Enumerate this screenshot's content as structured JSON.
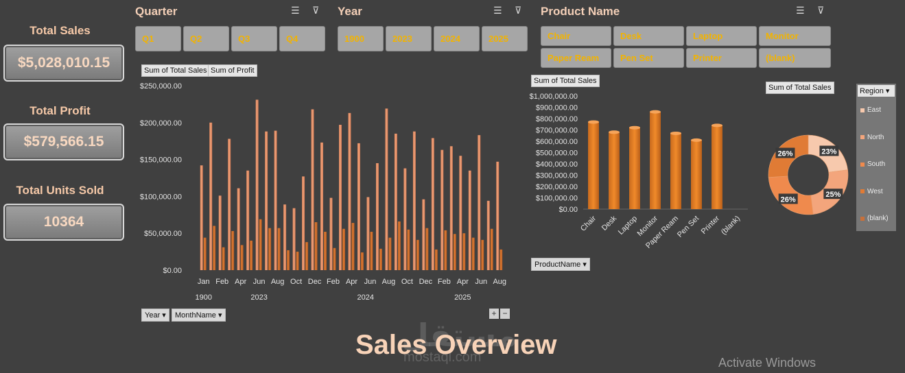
{
  "kpis": [
    {
      "title": "Total Sales",
      "value": "$5,028,010.15"
    },
    {
      "title": "Total Profit",
      "value": "$579,566.15"
    },
    {
      "title": "Total Units Sold",
      "value": "10364"
    }
  ],
  "slicers": {
    "quarter": {
      "title": "Quarter",
      "items": [
        "Q1",
        "Q2",
        "Q3",
        "Q4"
      ]
    },
    "year": {
      "title": "Year",
      "items": [
        "1900",
        "2023",
        "2024",
        "2025"
      ]
    },
    "product": {
      "title": "Product Name",
      "items": [
        "Chair",
        "Desk",
        "Laptop",
        "Monitor",
        "Paper Ream",
        "Pen Set",
        "Printer",
        "(blank)"
      ]
    }
  },
  "icons": {
    "multiselect": "multi-select-icon",
    "clearfilter": "clear-filter-icon"
  },
  "colors": {
    "sales": "#f1a37a",
    "profit": "#e07b35",
    "bar": "#f08a2a",
    "accent": "#f2b300"
  },
  "monthly_chart_fields": {
    "values": [
      "Sum of Total Sales",
      "Sum of Profit"
    ],
    "axis": [
      "Year",
      "MonthName"
    ]
  },
  "product_chart_fields": {
    "value": "Sum of Total Sales",
    "axis": "ProductName"
  },
  "donut_fields": {
    "value": "Sum of Total Sales",
    "legend_header": "Region"
  },
  "chart_data": [
    {
      "type": "bar",
      "categories": [
        "Jan",
        "Feb",
        "Mar",
        "Apr",
        "May",
        "Jun",
        "Jul",
        "Aug",
        "Sep",
        "Oct",
        "Nov",
        "Dec",
        "Jan",
        "Feb",
        "Mar",
        "Apr",
        "May",
        "Jun",
        "Jul",
        "Aug",
        "Sep",
        "Oct",
        "Nov",
        "Dec",
        "Jan",
        "Feb",
        "Mar",
        "Apr",
        "May",
        "Jun",
        "Jul",
        "Aug",
        "Sep"
      ],
      "tick_labels": [
        "Jan",
        "Feb",
        "Apr",
        "Jun",
        "Aug",
        "Oct",
        "Dec",
        "Feb",
        "Apr",
        "Jun",
        "Aug",
        "Oct",
        "Dec",
        "Feb",
        "Apr",
        "Jun",
        "Aug"
      ],
      "groups": [
        {
          "label": "1900",
          "count": 1
        },
        {
          "label": "2023",
          "count": 11
        },
        {
          "label": "2024",
          "count": 12
        },
        {
          "label": "2025",
          "count": 9
        }
      ],
      "series": [
        {
          "name": "Sum of Total Sales",
          "values": [
            142000,
            200000,
            101000,
            178000,
            111000,
            135000,
            231000,
            188000,
            189000,
            89000,
            84000,
            127000,
            218000,
            173000,
            98000,
            197000,
            213000,
            172000,
            99000,
            145000,
            219000,
            185000,
            138000,
            188000,
            96000,
            179000,
            163000,
            168000,
            155000,
            135000,
            183000,
            94000,
            147000
          ]
        },
        {
          "name": "Sum of Profit",
          "values": [
            44000,
            60000,
            31000,
            53000,
            34000,
            40000,
            69000,
            57000,
            57000,
            27000,
            25000,
            38000,
            65000,
            52000,
            30000,
            56000,
            64000,
            24000,
            52000,
            29000,
            44000,
            66000,
            55000,
            41000,
            57000,
            28000,
            54000,
            49000,
            50000,
            44000,
            41000,
            56000,
            28000
          ]
        }
      ],
      "ylim": [
        0,
        250000
      ],
      "yticks": [
        "$0.00",
        "$50,000.00",
        "$100,000.00",
        "$150,000.00",
        "$200,000.00",
        "$250,000.00"
      ],
      "legend": "top-left"
    },
    {
      "type": "bar",
      "categories": [
        "Chair",
        "Desk",
        "Laptop",
        "Monitor",
        "Paper Ream",
        "Pen Set",
        "Printer",
        "(blank)"
      ],
      "values": [
        770000,
        680000,
        720000,
        860000,
        670000,
        610000,
        740000,
        0
      ],
      "ylim": [
        0,
        1000000
      ],
      "yticks": [
        "$0.00",
        "$100,000.00",
        "$200,000.00",
        "$300,000.00",
        "$400,000.00",
        "$500,000.00",
        "$600,000.00",
        "$700,000.00",
        "$800,000.00",
        "$900,000.00",
        "$1,000,000.00"
      ]
    },
    {
      "type": "pie",
      "categories": [
        "East",
        "North",
        "South",
        "West",
        "(blank)"
      ],
      "values": [
        23,
        25,
        26,
        26,
        0
      ],
      "labels": [
        "23%",
        "25%",
        "26%",
        "26%",
        ""
      ],
      "colors": [
        "#f7c9ad",
        "#f3a57c",
        "#ef8a4d",
        "#e07b35",
        "#c8703a"
      ],
      "legend": "right"
    }
  ],
  "title": "Sales Overview",
  "watermark": {
    "text": "مستقل",
    "sub": "mostaql.com"
  },
  "activate": "Activate Windows"
}
